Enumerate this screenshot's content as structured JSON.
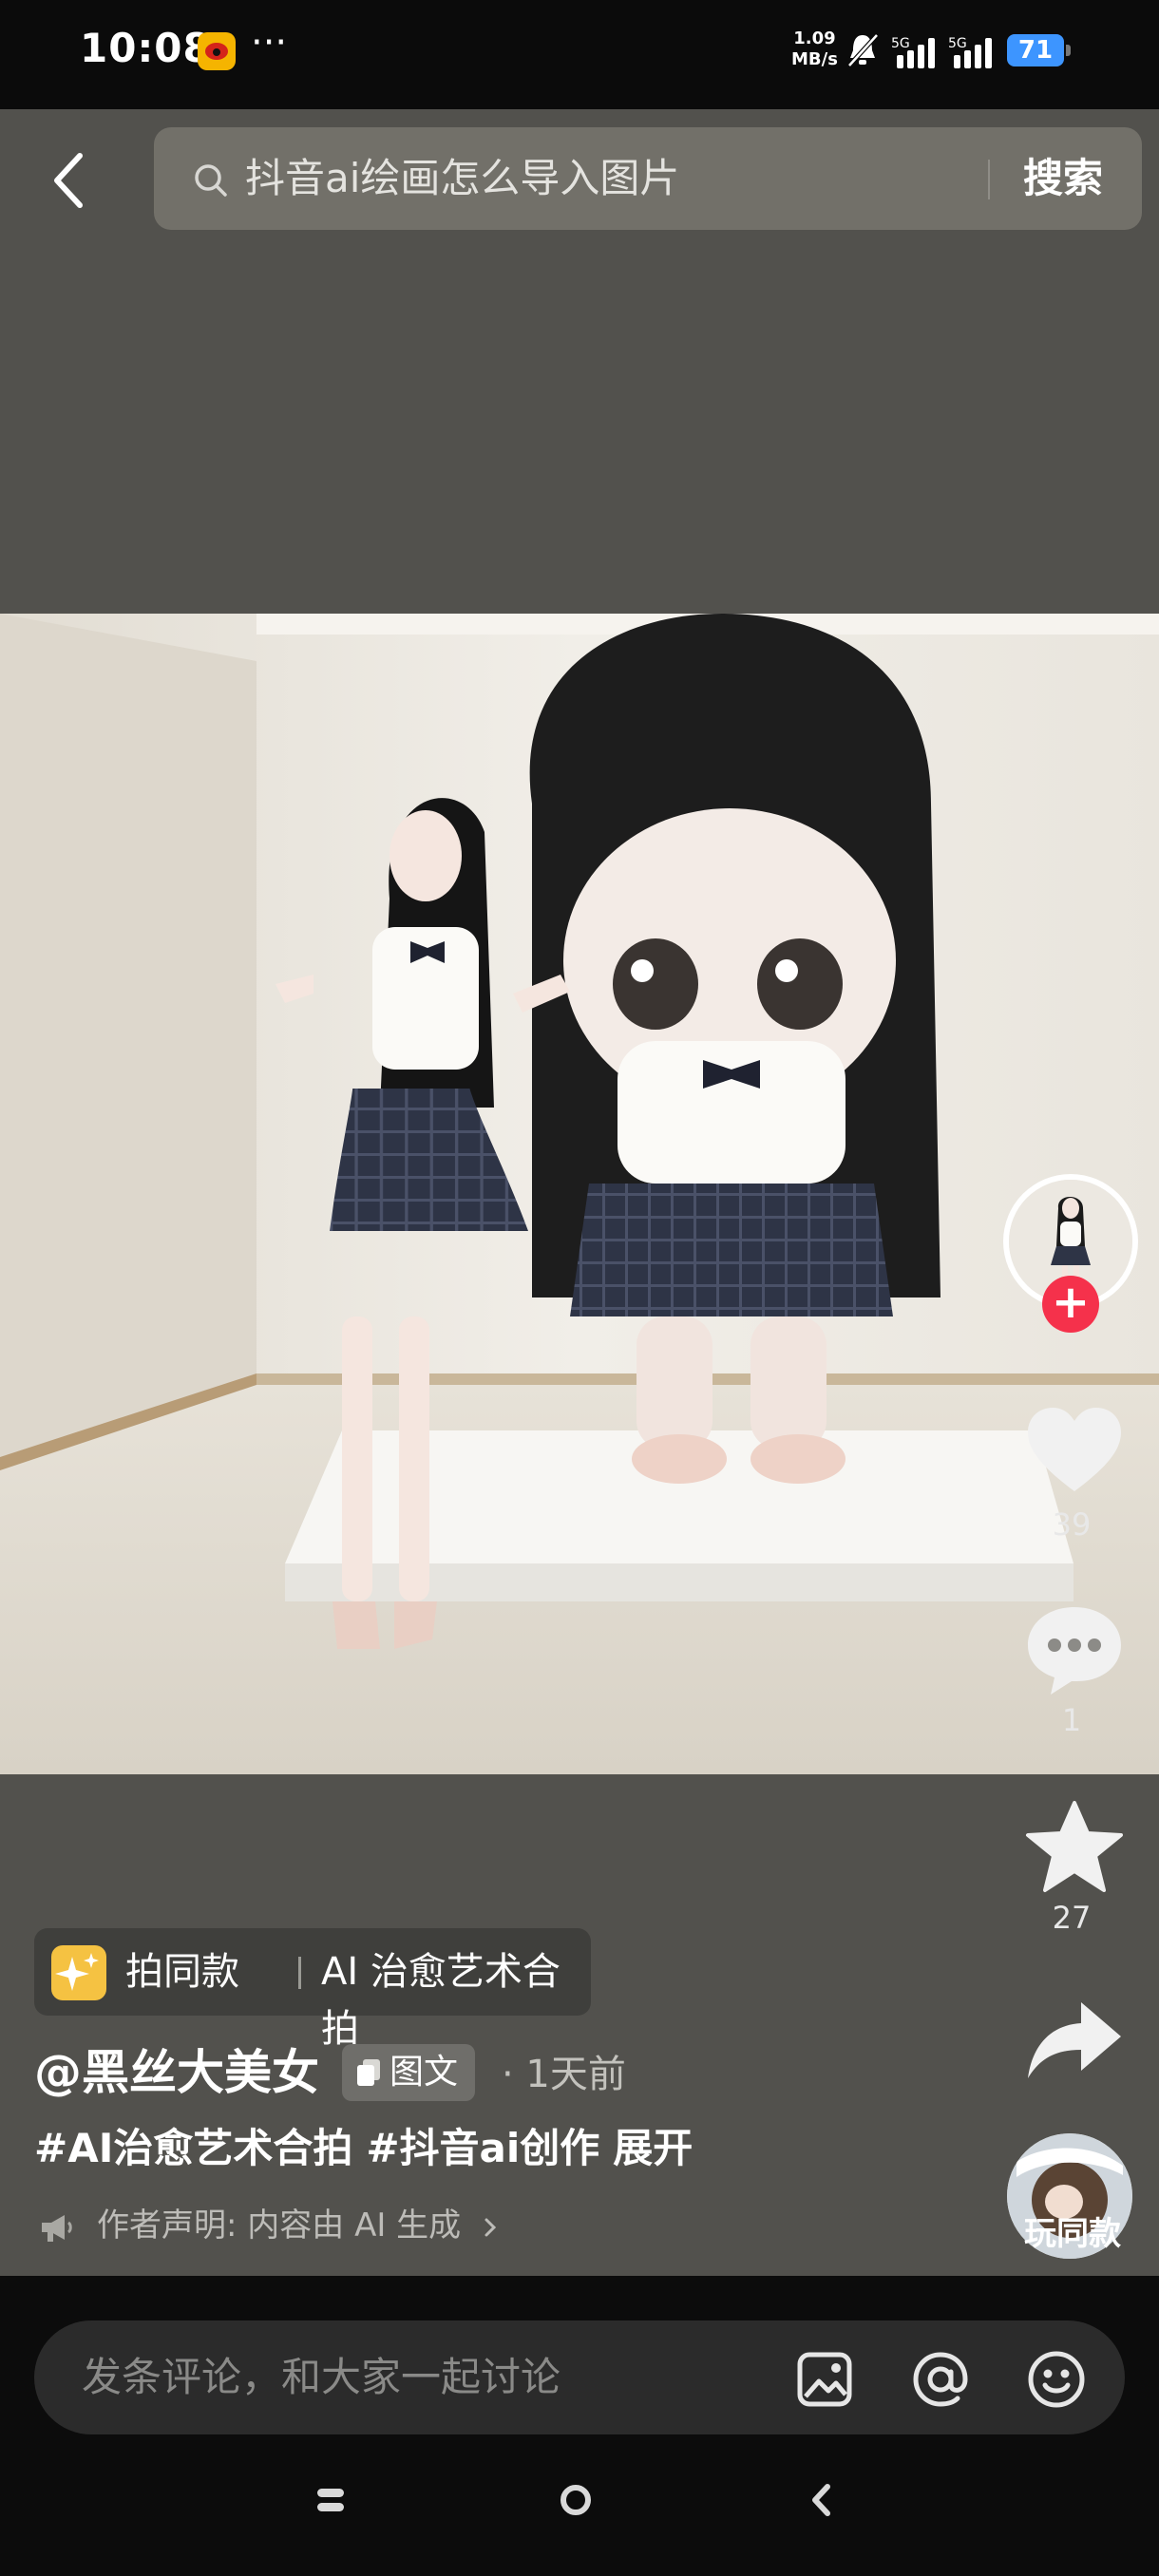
{
  "status_bar": {
    "time": "10:08",
    "more": "···",
    "net_speed_value": "1.09",
    "net_speed_unit": "MB/s",
    "battery": "71"
  },
  "search": {
    "query": "抖音ai绘画怎么导入图片",
    "button_label": "搜索"
  },
  "sidebar": {
    "likes": "39",
    "comments": "1",
    "favorites": "27",
    "play_same_label": "玩同款"
  },
  "post": {
    "template_label": "拍同款",
    "template_title": "AI 治愈艺术合拍",
    "author": "@黑丝大美女",
    "type_badge": "图文",
    "time": "· 1天前",
    "hashtags": [
      "#AI治愈艺术合拍",
      "#抖音ai创作"
    ],
    "expand": "展开",
    "declaration": "作者声明: 内容由 AI 生成"
  },
  "comment_bar": {
    "placeholder": "发条评论，和大家一起讨论"
  },
  "colors": {
    "background": "#52514d",
    "follow_red": "#f5314b",
    "battery_blue": "#3d95ff",
    "template_icon": "#f5c242"
  },
  "icons": [
    "back-arrow-icon",
    "search-icon",
    "heart-icon",
    "comment-icon",
    "star-icon",
    "share-icon",
    "image-icon",
    "at-icon",
    "emoji-icon"
  ]
}
